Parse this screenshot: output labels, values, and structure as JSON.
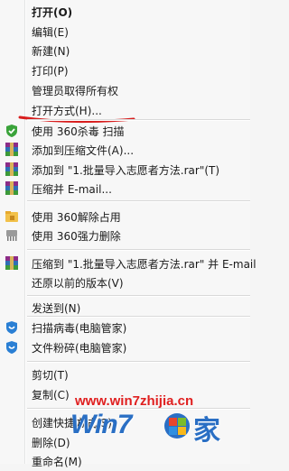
{
  "menu": {
    "items": [
      {
        "label": "打开(O)"
      },
      {
        "label": "编辑(E)"
      },
      {
        "label": "新建(N)"
      },
      {
        "label": "打印(P)"
      },
      {
        "label": "管理员取得所有权"
      },
      {
        "label": "打开方式(H)..."
      },
      {
        "label": "使用 360杀毒 扫描"
      },
      {
        "label": "添加到压缩文件(A)..."
      },
      {
        "label": "添加到 \"1.批量导入志愿者方法.rar\"(T)"
      },
      {
        "label": "压缩并 E-mail..."
      },
      {
        "label": "使用 360解除占用"
      },
      {
        "label": "使用 360强力删除"
      },
      {
        "label": "压缩到 \"1.批量导入志愿者方法.rar\" 并 E-mail"
      },
      {
        "label": "还原以前的版本(V)"
      },
      {
        "label": "发送到(N)"
      },
      {
        "label": "扫描病毒(电脑管家)"
      },
      {
        "label": "文件粉碎(电脑管家)"
      },
      {
        "label": "剪切(T)"
      },
      {
        "label": "复制(C)"
      },
      {
        "label": "创建快捷方式(S)"
      },
      {
        "label": "删除(D)"
      },
      {
        "label": "重命名(M)"
      }
    ]
  },
  "watermark": {
    "url": "www.win7zhijia.cn",
    "logo_text": "Win7",
    "logo_suffix": "家"
  },
  "colors": {
    "menu_bg": "#f7f7f7",
    "annotation_red": "#e02020",
    "watermark_blue": "#2a6fc4"
  }
}
